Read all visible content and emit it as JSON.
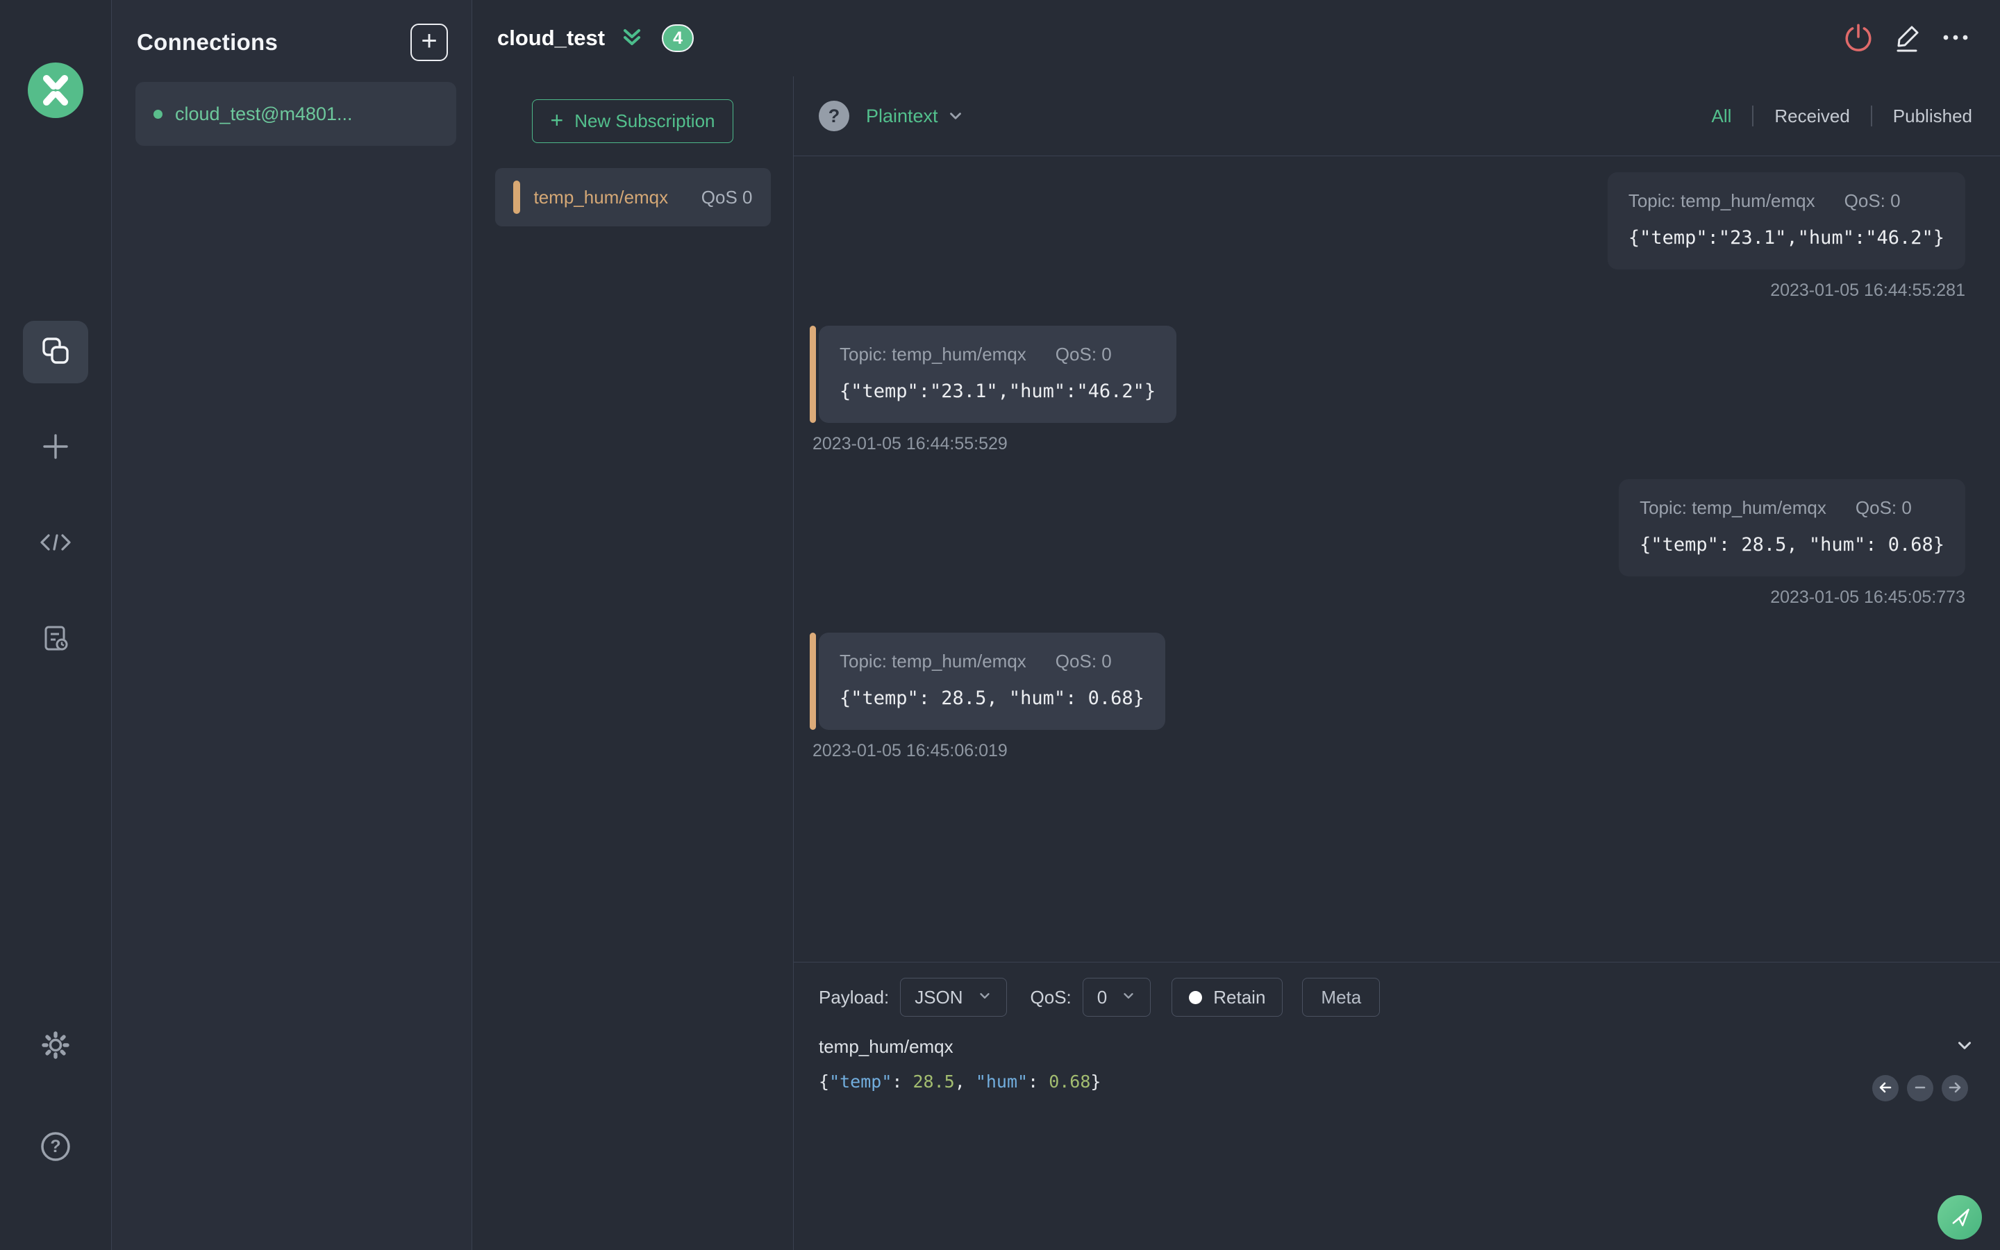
{
  "colors": {
    "accent_green": "#53c08d",
    "badge_green": "#5abd8c",
    "topic_orange": "#d5a876",
    "danger_red": "#e06a6a"
  },
  "icons": {
    "app-logo": "mqttx-x-mark",
    "add-connection": "+",
    "connections-nav": "overlapping-squares",
    "new-connection-nav": "+",
    "script-nav": "</>",
    "log-nav": "document-clock",
    "settings": "gear",
    "help": "?",
    "disconnect": "power-symbol",
    "edit": "pencil",
    "more": "...",
    "collapse": "double-chevron-down",
    "dropdown": "chevron-down",
    "format-help": "?",
    "retain-dot": "filled-circle",
    "prev": "arrow-left",
    "collapse-history": "minus",
    "next": "arrow-right",
    "send": "paper-plane"
  },
  "connections_panel": {
    "title": "Connections",
    "items": [
      {
        "name": "cloud_test@m4801...",
        "status": "connected"
      }
    ]
  },
  "header": {
    "title": "cloud_test",
    "badge_count": "4"
  },
  "subscriptions": {
    "new_button_label": "New Subscription",
    "items": [
      {
        "topic": "temp_hum/emqx",
        "qos": "QoS 0"
      }
    ]
  },
  "messages": {
    "format_label": "Plaintext",
    "filter_tabs": [
      {
        "label": "All",
        "active": true
      },
      {
        "label": "Received",
        "active": false
      },
      {
        "label": "Published",
        "active": false
      }
    ],
    "items": [
      {
        "side": "right",
        "topic_label": "Topic: temp_hum/emqx",
        "qos_label": "QoS: 0",
        "payload": "{\"temp\":\"23.1\",\"hum\":\"46.2\"}",
        "timestamp": "2023-01-05 16:44:55:281"
      },
      {
        "side": "left",
        "topic_label": "Topic: temp_hum/emqx",
        "qos_label": "QoS: 0",
        "payload": "{\"temp\":\"23.1\",\"hum\":\"46.2\"}",
        "timestamp": "2023-01-05 16:44:55:529"
      },
      {
        "side": "right",
        "topic_label": "Topic: temp_hum/emqx",
        "qos_label": "QoS: 0",
        "payload": "{\"temp\": 28.5, \"hum\": 0.68}",
        "timestamp": "2023-01-05 16:45:05:773"
      },
      {
        "side": "left",
        "topic_label": "Topic: temp_hum/emqx",
        "qos_label": "QoS: 0",
        "payload": "{\"temp\": 28.5, \"hum\": 0.68}",
        "timestamp": "2023-01-05 16:45:06:019"
      }
    ]
  },
  "publish": {
    "payload_label": "Payload:",
    "payload_format": "JSON",
    "qos_label": "QoS:",
    "qos_value": "0",
    "retain_label": "Retain",
    "meta_label": "Meta",
    "topic_value": "temp_hum/emqx",
    "tokens": [
      {
        "text": "{",
        "type": "punct"
      },
      {
        "text": "\"temp\"",
        "type": "key"
      },
      {
        "text": ": ",
        "type": "punct"
      },
      {
        "text": "28.5",
        "type": "num"
      },
      {
        "text": ", ",
        "type": "punct"
      },
      {
        "text": "\"hum\"",
        "type": "key"
      },
      {
        "text": ": ",
        "type": "punct"
      },
      {
        "text": "0.68",
        "type": "num"
      },
      {
        "text": "}",
        "type": "punct"
      }
    ]
  }
}
